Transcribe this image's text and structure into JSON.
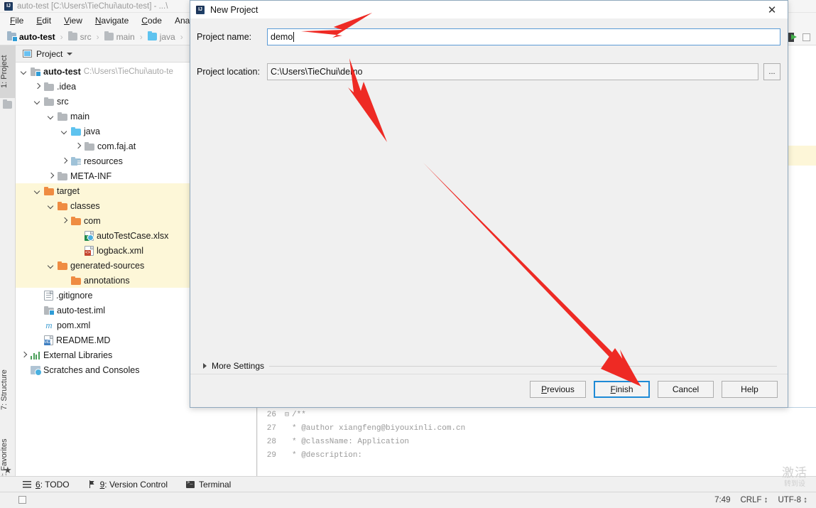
{
  "ide": {
    "title": "auto-test [C:\\Users\\TieChui\\auto-test] - ...\\",
    "menu": [
      "File",
      "Edit",
      "View",
      "Navigate",
      "Code",
      "Analyze"
    ],
    "breadcrumb": [
      "auto-test",
      "src",
      "main",
      "java"
    ],
    "breadcrumb_sep": "›"
  },
  "left_rail": {
    "tabs": [
      {
        "label": "1: Project",
        "selected": true
      },
      {
        "label": "7: Structure",
        "selected": false
      },
      {
        "label": "2: Favorites",
        "selected": false
      }
    ]
  },
  "project_panel": {
    "header_label": "Project",
    "tree": [
      {
        "depth": 0,
        "arrow": "down",
        "icon": "module-folder",
        "label": "auto-test",
        "bold": true,
        "path": "C:\\Users\\TieChui\\auto-te",
        "highlight": false
      },
      {
        "depth": 1,
        "arrow": "right",
        "icon": "folder-gray",
        "label": ".idea",
        "bold": false,
        "path": "",
        "highlight": false
      },
      {
        "depth": 1,
        "arrow": "down",
        "icon": "folder-gray",
        "label": "src",
        "bold": false,
        "path": "",
        "highlight": false
      },
      {
        "depth": 2,
        "arrow": "down",
        "icon": "folder-gray",
        "label": "main",
        "bold": false,
        "path": "",
        "highlight": false
      },
      {
        "depth": 3,
        "arrow": "down",
        "icon": "folder-blue",
        "label": "java",
        "bold": false,
        "path": "",
        "highlight": false
      },
      {
        "depth": 4,
        "arrow": "right",
        "icon": "folder-gray",
        "label": "com.faj.at",
        "bold": false,
        "path": "",
        "highlight": false
      },
      {
        "depth": 3,
        "arrow": "right",
        "icon": "folder-resource",
        "label": "resources",
        "bold": false,
        "path": "",
        "highlight": false
      },
      {
        "depth": 2,
        "arrow": "right",
        "icon": "folder-gray",
        "label": "META-INF",
        "bold": false,
        "path": "",
        "highlight": false
      },
      {
        "depth": 1,
        "arrow": "down",
        "icon": "folder-orange",
        "label": "target",
        "bold": false,
        "path": "",
        "highlight": true
      },
      {
        "depth": 2,
        "arrow": "down",
        "icon": "folder-orange",
        "label": "classes",
        "bold": false,
        "path": "",
        "highlight": true
      },
      {
        "depth": 3,
        "arrow": "right",
        "icon": "folder-orange",
        "label": "com",
        "bold": false,
        "path": "",
        "highlight": true
      },
      {
        "depth": 4,
        "arrow": "none",
        "icon": "xlsx-file",
        "label": "autoTestCase.xlsx",
        "bold": false,
        "path": "",
        "highlight": true
      },
      {
        "depth": 4,
        "arrow": "none",
        "icon": "xml-file",
        "label": "logback.xml",
        "bold": false,
        "path": "",
        "highlight": true
      },
      {
        "depth": 2,
        "arrow": "down",
        "icon": "folder-orange",
        "label": "generated-sources",
        "bold": false,
        "path": "",
        "highlight": true
      },
      {
        "depth": 3,
        "arrow": "none",
        "icon": "folder-orange",
        "label": "annotations",
        "bold": false,
        "path": "",
        "highlight": true
      },
      {
        "depth": 1,
        "arrow": "none",
        "icon": "git-file",
        "label": ".gitignore",
        "bold": false,
        "path": "",
        "highlight": false
      },
      {
        "depth": 1,
        "arrow": "none",
        "icon": "iml-file",
        "label": "auto-test.iml",
        "bold": false,
        "path": "",
        "highlight": false
      },
      {
        "depth": 1,
        "arrow": "none",
        "icon": "maven-file",
        "label": "pom.xml",
        "bold": false,
        "path": "",
        "highlight": false
      },
      {
        "depth": 1,
        "arrow": "none",
        "icon": "md-file",
        "label": "README.MD",
        "bold": false,
        "path": "",
        "highlight": false
      },
      {
        "depth": 0,
        "arrow": "right",
        "icon": "library-icon",
        "label": "External Libraries",
        "bold": false,
        "path": "",
        "highlight": false
      },
      {
        "depth": 0,
        "arrow": "none",
        "icon": "scratches-icon",
        "label": "Scratches and Consoles",
        "bold": false,
        "path": "",
        "highlight": false
      }
    ]
  },
  "editor": {
    "code_lines": [
      {
        "num": "26",
        "fold": "⊟",
        "text": "/**"
      },
      {
        "num": "27",
        "fold": "",
        "text": "* @author xiangfeng@biyouxinli.com.cn"
      },
      {
        "num": "28",
        "fold": "",
        "text": "* @className: Application"
      },
      {
        "num": "29",
        "fold": "",
        "text": "* @description:"
      }
    ]
  },
  "dialog": {
    "title": "New Project",
    "close_label": "✕",
    "project_name_label": "Project name:",
    "project_name_value": "demo",
    "project_location_label": "Project location:",
    "project_location_value": "C:\\Users\\TieChui\\demo",
    "browse_label": "...",
    "more_settings_label": "More Settings",
    "buttons": [
      {
        "label": "Previous",
        "mnemonic": "P",
        "default": false
      },
      {
        "label": "Finish",
        "mnemonic": "F",
        "default": true
      },
      {
        "label": "Cancel",
        "mnemonic": "",
        "default": false
      },
      {
        "label": "Help",
        "mnemonic": "",
        "default": false
      }
    ]
  },
  "bottom": {
    "tabs": [
      {
        "label": "6: TODO",
        "icon": "todo-list-icon"
      },
      {
        "label": "9: Version Control",
        "icon": "version-control-icon"
      },
      {
        "label": "Terminal",
        "icon": "terminal-icon"
      }
    ]
  },
  "status": {
    "caret_position": "7:49",
    "line_separator": "CRLF",
    "encoding": "UTF-8"
  },
  "watermark": {
    "line1": "激活",
    "line2": "转到设"
  },
  "colors": {
    "accent_blue": "#1e8ad6",
    "highlight_yellow": "#fdf7d8",
    "annotation_red": "#ee2a24",
    "folder_orange": "#ef8c42",
    "folder_blue": "#5ec3ef"
  }
}
